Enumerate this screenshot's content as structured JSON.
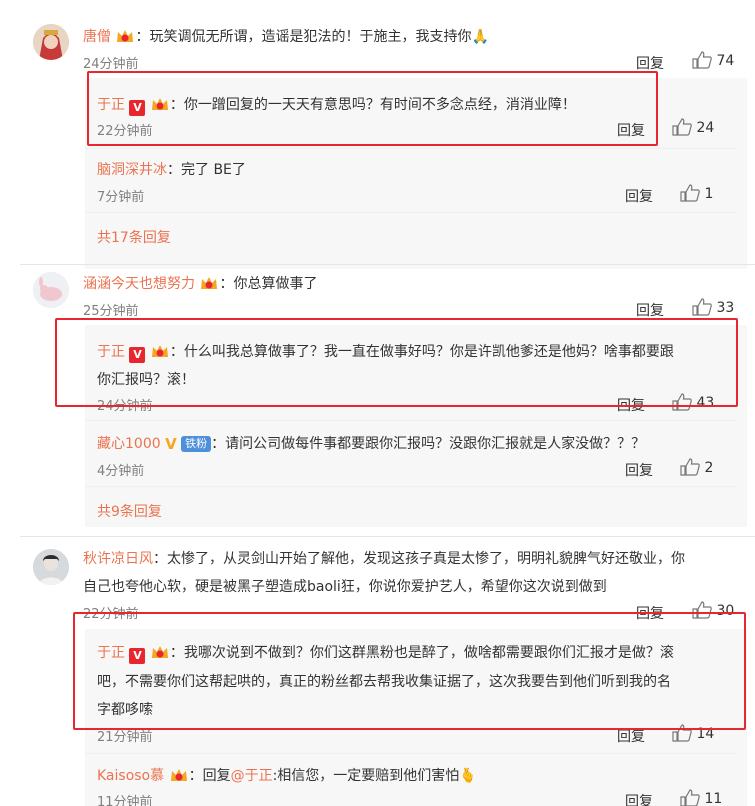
{
  "comments": [
    {
      "user": "唐僧",
      "text": "：玩笑调侃无所谓，造谣是犯法的！于施主，我支持你",
      "emoji": "🙏",
      "time": "24分钟前",
      "reply_label": "回复",
      "likes": "74",
      "replies": [
        {
          "user": "于正",
          "text": "：你一蹭回复的一天天有意思吗？有时间不多念点经，消消业障！",
          "time": "22分钟前",
          "reply_label": "回复",
          "likes": "24"
        },
        {
          "user": "脑洞深井冰",
          "text": "：完了  BE了",
          "time": "7分钟前",
          "reply_label": "回复",
          "likes": "1"
        }
      ],
      "more": "共17条回复"
    },
    {
      "user": "涵涵今天也想努力",
      "text": "：你总算做事了",
      "time": "25分钟前",
      "reply_label": "回复",
      "likes": "33",
      "replies": [
        {
          "user": "于正",
          "text_line1": "：什么叫我总算做事了？我一直在做事好吗？你是许凯他爹还是他妈？啥事都要跟",
          "text_line2": "你汇报吗？滚！",
          "time": "24分钟前",
          "reply_label": "回复",
          "likes": "43"
        },
        {
          "user": "藏心1000",
          "fan_badge": "铁粉",
          "text": "：请问公司做每件事都要跟你汇报吗？没跟你汇报就是人家没做？？？",
          "time": "4分钟前",
          "reply_label": "回复",
          "likes": "2"
        }
      ],
      "more": "共9条回复"
    },
    {
      "user": "秋许凉日风",
      "text_line1": "：太惨了，从灵剑山开始了解他，发现这孩子真是太惨了，明明礼貌脾气好还敬业，你",
      "text_line2": "自己也夸他心软，硬是被黑子塑造成baoli狂，你说你爱护艺人，希望你这次说到做到",
      "time": "22分钟前",
      "reply_label": "回复",
      "likes": "30",
      "replies": [
        {
          "user": "于正",
          "text_line1": "：我哪次说到不做到？你们这群黑粉也是醉了，做啥都需要跟你们汇报才是做？滚",
          "text_line2": "吧，不需要你们这帮起哄的，真正的粉丝都去帮我收集证据了，这次我要告到他们听到我的名",
          "text_line3": "字都哆嗦",
          "time": "21分钟前",
          "reply_label": "回复",
          "likes": "14"
        },
        {
          "user": "Kaisoso慕",
          "text_prefix": "：回复",
          "mention": "@于正",
          "text": ":相信您，一定要赔到他们害怕",
          "emoji": "🫰",
          "time": "11分钟前",
          "reply_label": "回复",
          "likes": "11"
        }
      ]
    }
  ],
  "colors": {
    "name": "#eb7350",
    "highlight_box": "#e8262d",
    "reply_bg": "#f7f7f7"
  }
}
